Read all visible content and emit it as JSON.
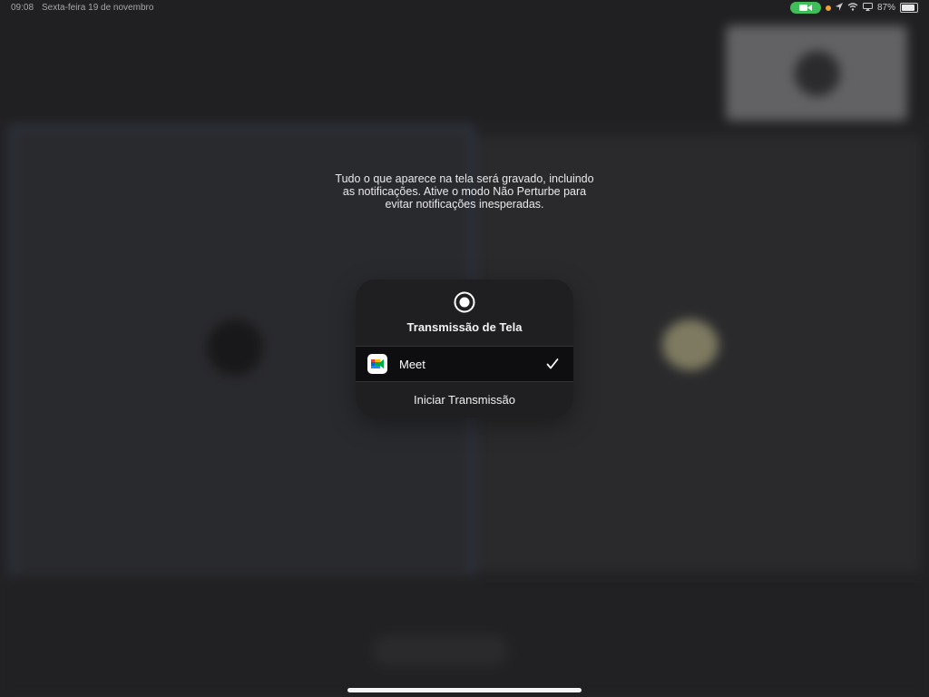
{
  "status_bar": {
    "time": "09:08",
    "date": "Sexta-feira 19 de novembro",
    "battery_percent": "87%",
    "camera_indicator_color": "#3fbe5a",
    "mic_dot_color": "#f0a030",
    "battery_level": 0.87
  },
  "notice": {
    "text": "Tudo o que aparece na tela será gravado, incluindo as notificações. Ative o modo Não Perturbe para evitar notificações inesperadas."
  },
  "broadcast_card": {
    "icon": "record-icon",
    "title": "Transmissão de Tela",
    "options": [
      {
        "label": "Meet",
        "icon": "meet-app-icon",
        "selected": true
      }
    ],
    "start_label": "Iniciar Transmissão"
  }
}
